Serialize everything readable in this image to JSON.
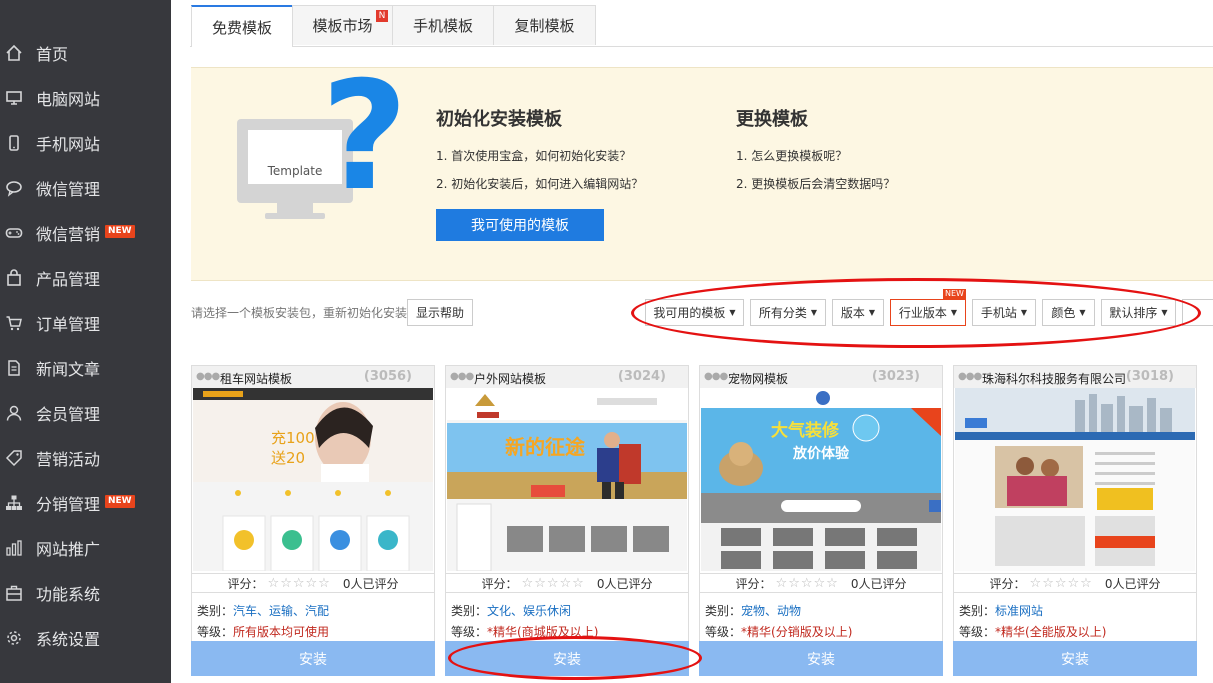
{
  "sidebar": {
    "items": [
      {
        "label": "首页",
        "icon": "home-icon"
      },
      {
        "label": "电脑网站",
        "icon": "monitor-icon"
      },
      {
        "label": "手机网站",
        "icon": "phone-icon"
      },
      {
        "label": "微信管理",
        "icon": "chat-icon"
      },
      {
        "label": "微信营销",
        "icon": "gamepad-icon",
        "badge": "NEW"
      },
      {
        "label": "产品管理",
        "icon": "bag-icon"
      },
      {
        "label": "订单管理",
        "icon": "cart-icon"
      },
      {
        "label": "新闻文章",
        "icon": "document-icon"
      },
      {
        "label": "会员管理",
        "icon": "user-icon"
      },
      {
        "label": "营销活动",
        "icon": "tag-icon"
      },
      {
        "label": "分销管理",
        "icon": "sitemap-icon",
        "badge": "NEW"
      },
      {
        "label": "网站推广",
        "icon": "bar-chart-icon"
      },
      {
        "label": "功能系统",
        "icon": "toolbox-icon"
      },
      {
        "label": "系统设置",
        "icon": "gear-icon"
      }
    ]
  },
  "tabs": [
    {
      "label": "免费模板"
    },
    {
      "label": "模板市场",
      "badge": "N"
    },
    {
      "label": "手机模板"
    },
    {
      "label": "复制模板"
    }
  ],
  "banner": {
    "illustration_text": "Template",
    "col1": {
      "title": "初始化安装模板",
      "items": [
        "1. 首次使用宝盒，如何初始化安装？",
        "2. 初始化安装后，如何进入编辑网站？"
      ]
    },
    "col2": {
      "title": "更换模板",
      "items": [
        "1. 怎么更换模板呢？",
        "2. 更换模板后会清空数据吗？"
      ]
    },
    "button": "我可使用的模板"
  },
  "filter": {
    "hint": "请选择一个模板安装包，重新初始化安装",
    "help_button": "显示帮助",
    "dropdowns": [
      "我可用的模板",
      "所有分类",
      "版本",
      "行业版本",
      "手机站",
      "颜色",
      "默认排序"
    ],
    "new_badge": "NEW"
  },
  "cards": [
    {
      "title": "租车网站模板",
      "count": "(3056)",
      "rating_label": "评分：",
      "stars": "☆☆☆☆☆",
      "rated": "0人已评分",
      "category_label": "类别：",
      "category": "汽车、运输、汽配",
      "level_label": "等级：",
      "level": "所有版本均可使用",
      "install": "安装",
      "thumb_text": "充100\n送20"
    },
    {
      "title": "户外网站模板",
      "count": "(3024)",
      "rating_label": "评分：",
      "stars": "☆☆☆☆☆",
      "rated": "0人已评分",
      "category_label": "类别：",
      "category": "文化、娱乐休闲",
      "level_label": "等级：",
      "level": "*精华(商城版及以上)",
      "install": "安装",
      "thumb_text": "新的征途"
    },
    {
      "title": "宠物网模板",
      "count": "(3023)",
      "rating_label": "评分：",
      "stars": "☆☆☆☆☆",
      "rated": "0人已评分",
      "category_label": "类别：",
      "category": "宠物、动物",
      "level_label": "等级：",
      "level": "*精华(分销版及以上)",
      "install": "安装",
      "thumb_text": "大气装修 放价体验"
    },
    {
      "title": "珠海科尔科技服务有限公司",
      "count": "(3018)",
      "rating_label": "评分：",
      "stars": "☆☆☆☆☆",
      "rated": "0人已评分",
      "category_label": "类别：",
      "category": "标准网站",
      "level_label": "等级：",
      "level": "*精华(全能版及以上)",
      "install": "安装",
      "thumb_text": ""
    }
  ],
  "colors": {
    "accent": "#1f7be0",
    "sidebar_bg": "#37383d",
    "banner_bg": "#fdf7e3",
    "install_bg": "#8ab9f1",
    "annotation": "#e41212"
  }
}
